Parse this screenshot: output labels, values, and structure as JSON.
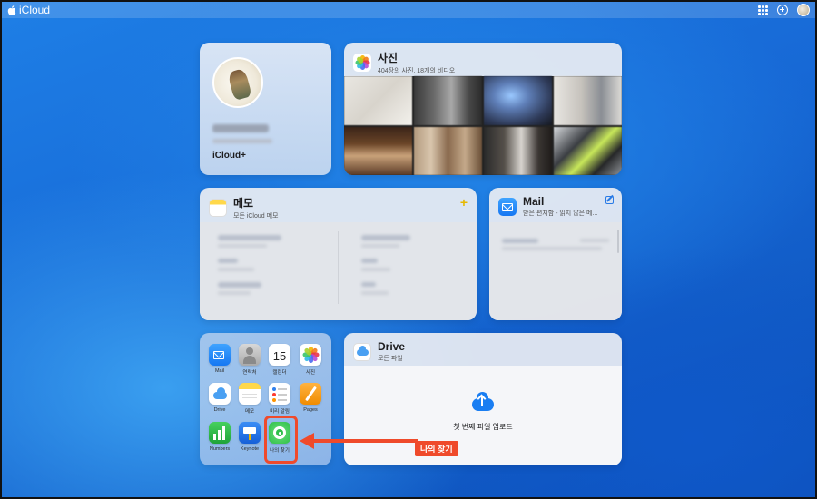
{
  "topbar": {
    "brand": "iCloud"
  },
  "profile": {
    "plan": "iCloud+"
  },
  "photos": {
    "title": "사진",
    "subtitle": "404장의 사진, 18개의 비디오"
  },
  "memo": {
    "title": "메모",
    "subtitle": "모든 iCloud 메모"
  },
  "mail": {
    "title": "Mail",
    "subtitle": "받은 편지함 - 읽지 않은 메..."
  },
  "apps": [
    {
      "label": "Mail",
      "icon": "mail-icon"
    },
    {
      "label": "연락처",
      "icon": "contacts-icon"
    },
    {
      "label": "캘린더",
      "icon": "calendar-icon",
      "day": "15"
    },
    {
      "label": "사진",
      "icon": "photos-icon"
    },
    {
      "label": "Drive",
      "icon": "drive-icon"
    },
    {
      "label": "메모",
      "icon": "notes-icon"
    },
    {
      "label": "미리 알림",
      "icon": "reminders-icon"
    },
    {
      "label": "Pages",
      "icon": "pages-icon"
    },
    {
      "label": "Numbers",
      "icon": "numbers-icon"
    },
    {
      "label": "Keynote",
      "icon": "keynote-icon"
    },
    {
      "label": "나의 찾기",
      "icon": "find-my-icon"
    }
  ],
  "drive": {
    "title": "Drive",
    "subtitle": "모든 파일",
    "upload_label": "첫 번째 파일 업로드"
  },
  "annotation": {
    "callout": "나의 찾기",
    "color": "#ef4a2b"
  }
}
